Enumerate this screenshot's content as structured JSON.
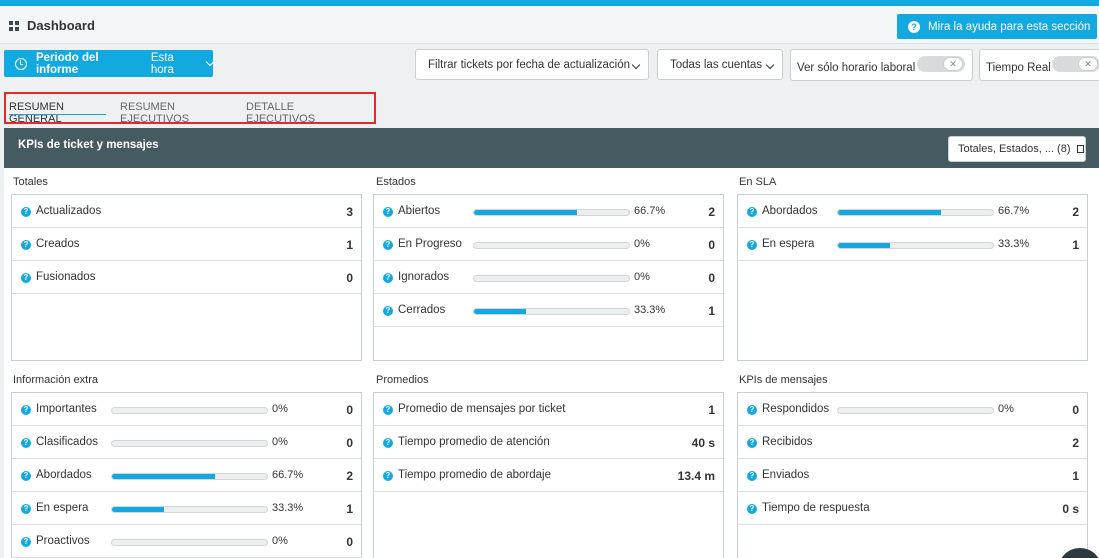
{
  "header": {
    "title": "Dashboard",
    "help_button": "Mira la ayuda para esta sección"
  },
  "toolbar": {
    "periodo_label": "Periodo del informe",
    "periodo_value": "Esta hora",
    "filter_select": "Filtrar tickets por fecha de actualización",
    "accounts_select": "Todas las cuentas",
    "horario_label": "Ver sólo horario laboral",
    "tiempo_real_label": "Tiempo Real"
  },
  "tabs": [
    {
      "label": "RESUMEN GENERAL",
      "active": true
    },
    {
      "label": "RESUMEN EJECUTIVOS",
      "active": false
    },
    {
      "label": "DETALLE EJECUTIVOS",
      "active": false
    }
  ],
  "kpi": {
    "title": "KPIs de ticket y mensajes",
    "totales_button": "Totales, Estados, ... (8)"
  },
  "sections": {
    "totales": {
      "title": "Totales",
      "rows": [
        {
          "name": "Actualizados",
          "value": "3"
        },
        {
          "name": "Creados",
          "value": "1"
        },
        {
          "name": "Fusionados",
          "value": "0"
        }
      ]
    },
    "estados": {
      "title": "Estados",
      "rows": [
        {
          "name": "Abiertos",
          "pct": "66.7%",
          "fraction": 0.667,
          "value": "2"
        },
        {
          "name": "En Progreso",
          "pct": "0%",
          "fraction": 0,
          "value": "0"
        },
        {
          "name": "Ignorados",
          "pct": "0%",
          "fraction": 0,
          "value": "0"
        },
        {
          "name": "Cerrados",
          "pct": "33.3%",
          "fraction": 0.333,
          "value": "1"
        }
      ]
    },
    "en_sla": {
      "title": "En SLA",
      "rows": [
        {
          "name": "Abordados",
          "pct": "66.7%",
          "fraction": 0.667,
          "value": "2"
        },
        {
          "name": "En espera",
          "pct": "33.3%",
          "fraction": 0.333,
          "value": "1"
        }
      ]
    },
    "info_extra": {
      "title": "Información extra",
      "rows": [
        {
          "name": "Importantes",
          "pct": "0%",
          "fraction": 0,
          "value": "0"
        },
        {
          "name": "Clasificados",
          "pct": "0%",
          "fraction": 0,
          "value": "0"
        },
        {
          "name": "Abordados",
          "pct": "66.7%",
          "fraction": 0.667,
          "value": "2"
        },
        {
          "name": "En espera",
          "pct": "33.3%",
          "fraction": 0.333,
          "value": "1"
        },
        {
          "name": "Proactivos",
          "pct": "0%",
          "fraction": 0,
          "value": "0"
        }
      ]
    },
    "promedios": {
      "title": "Promedios",
      "rows": [
        {
          "name": "Promedio de mensajes por ticket",
          "value": "1"
        },
        {
          "name": "Tiempo promedio de atención",
          "value": "40 s"
        },
        {
          "name": "Tiempo promedio de abordaje",
          "value": "13.4 m"
        }
      ]
    },
    "kpis_mensajes": {
      "title": "KPIs de mensajes",
      "rows": [
        {
          "name": "Respondidos",
          "pct": "0%",
          "fraction": 0,
          "value": "0"
        },
        {
          "name": "Recibidos",
          "value": "2"
        },
        {
          "name": "Enviados",
          "value": "1"
        },
        {
          "name": "Tiempo de respuesta",
          "value": "0 s"
        }
      ]
    }
  },
  "colors": {
    "accent": "#12a9e1",
    "kpi_header": "#465a62",
    "highlight": "#e22a2a"
  }
}
